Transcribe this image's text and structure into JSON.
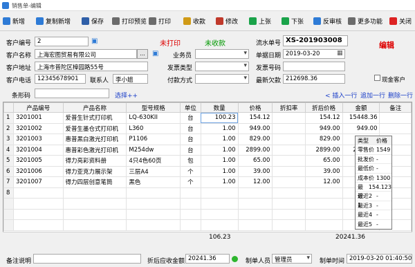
{
  "window": {
    "title": "销售单-编辑"
  },
  "toolbar": [
    {
      "label": "新增",
      "icon": "add-icon",
      "color": "#2e7bd6"
    },
    {
      "label": "复制新增",
      "icon": "copy-add-icon",
      "color": "#2e7bd6"
    },
    {
      "label": "保存",
      "icon": "save-icon",
      "color": "#2f5fa8"
    },
    {
      "label": "打印预览",
      "icon": "print-preview-icon",
      "color": "#6b6b6b"
    },
    {
      "label": "打印",
      "icon": "print-icon",
      "color": "#6b6b6b"
    },
    {
      "label": "收款",
      "icon": "receive-payment-icon",
      "color": "#d09a16"
    },
    {
      "label": "修改",
      "icon": "edit-icon",
      "color": "#c0392b"
    },
    {
      "label": "上张",
      "icon": "previous-icon",
      "color": "#1aa34a"
    },
    {
      "label": "下张",
      "icon": "next-icon",
      "color": "#1aa34a"
    },
    {
      "label": "反审核",
      "icon": "unaudit-icon",
      "color": "#2e7bd6"
    },
    {
      "label": "更多功能",
      "icon": "more-functions-icon",
      "color": "#6b6b6b"
    },
    {
      "label": "关闭",
      "icon": "close-icon",
      "color": "#d22"
    }
  ],
  "form": {
    "customer_code_label": "客户编号",
    "customer_code": "2",
    "print_status": "未打印",
    "payment_status": "未收款",
    "serial_label": "流水单号",
    "serial_value": "XS-201903008",
    "edit_flag": "编辑",
    "customer_name_label": "客户名称",
    "customer_name": "上海宏图贸易有限公司",
    "salesperson_label": "业务员",
    "salesperson": "",
    "doc_date_label": "单据日期",
    "doc_date": "2019-03-20",
    "address_label": "客户地址",
    "address": "上海市普陀区樟园路55号",
    "invoice_type_label": "发票类型",
    "invoice_type": "",
    "invoice_no_label": "发票号码",
    "invoice_no": "",
    "phone_label": "客户电话",
    "phone": "12345678901",
    "contact_label": "联系人",
    "contact": "李小姐",
    "pay_method_label": "付款方式",
    "pay_method": "",
    "latest_debt_label": "最新欠款",
    "latest_debt": "212698.36",
    "cash_customer_label": "现金客户",
    "barcode_label": "条形码",
    "barcode": "",
    "select_link": "选择++",
    "insert_row": "< 插入一行",
    "append_row": "追加一行",
    "delete_row": "删除一行"
  },
  "grid": {
    "columns": [
      "产品编号",
      "产品名称",
      "型号规格",
      "单位",
      "数量",
      "价格",
      "折扣率",
      "折后价格",
      "金额",
      "备注"
    ],
    "rows": [
      [
        "3201001",
        "爱普生针式打印机",
        "LQ-630KII",
        "台",
        "100.23",
        "154.12",
        "",
        "154.12",
        "15448.36",
        ""
      ],
      [
        "3201002",
        "爱普生墨仓式打印机",
        "L360",
        "台",
        "1.00",
        "949.00",
        "",
        "949.00",
        "949.00",
        ""
      ],
      [
        "3201003",
        "惠普黑白激光打印机",
        "P1106",
        "台",
        "1.00",
        "829.00",
        "",
        "829.00",
        "829.00",
        ""
      ],
      [
        "3201004",
        "惠普彩色激光打印机",
        "M254dw",
        "台",
        "1.00",
        "2899.00",
        "",
        "2899.00",
        "2899.00",
        ""
      ],
      [
        "3201005",
        "得力亮彩资料册",
        "4只4色60页",
        "包",
        "1.00",
        "65.00",
        "",
        "65.00",
        "65.00",
        ""
      ],
      [
        "3201006",
        "得力亚克力展示架",
        "三层A4",
        "个",
        "1.00",
        "39.00",
        "",
        "39.00",
        "39.00",
        ""
      ],
      [
        "3201007",
        "得力四层创意笔筒",
        "黑色",
        "个",
        "1.00",
        "12.00",
        "",
        "12.00",
        "12.00",
        ""
      ],
      [
        "",
        "",
        "",
        "",
        "",
        "",
        "",
        "",
        "",
        ""
      ]
    ],
    "totals": {
      "quantity": "106.23",
      "amount": "20241.36"
    }
  },
  "price_popup": {
    "header": [
      "类型",
      "价格"
    ],
    "rows": [
      [
        "零售价",
        "1549"
      ],
      [
        "批发价",
        "-"
      ],
      [
        "最低价",
        "-"
      ],
      [
        "成本价",
        "1300"
      ],
      [
        "最近1",
        "154.123"
      ],
      [
        "最近2",
        "-"
      ],
      [
        "最近3",
        "-"
      ],
      [
        "最近4",
        "-"
      ],
      [
        "最近5",
        "-"
      ]
    ]
  },
  "footer": {
    "remark_label": "备注说明",
    "remark": "",
    "receivable_label": "折后应收金额",
    "receivable": "20241.36",
    "maker_label": "制单人员",
    "maker": "管理员",
    "make_time_label": "制单时间",
    "make_time": "2019-03-20 01:40:50"
  }
}
